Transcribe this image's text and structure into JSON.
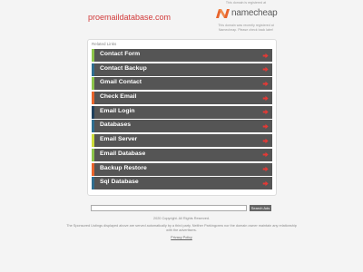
{
  "domain": "proemaildatabase.com",
  "registrar": {
    "registered_text": "This domain is registered at",
    "brand": "namecheap",
    "note": "This domain was recently registered at Namecheap. Please check back later!",
    "colors": {
      "brand_orange": "#e8642c",
      "brand_text": "#5a5a5a"
    }
  },
  "related": {
    "title": "Related Links",
    "items": [
      {
        "label": "Contact Form",
        "accent": "#8bc34a"
      },
      {
        "label": "Contact Backup",
        "accent": "#2f6d8f"
      },
      {
        "label": "Gmail Contact",
        "accent": "#8bc34a"
      },
      {
        "label": "Check Email",
        "accent": "#e8642c"
      },
      {
        "label": "Email Login",
        "accent": "#1f3f5c"
      },
      {
        "label": "Databases",
        "accent": "#2f6d8f"
      },
      {
        "label": "Email Server",
        "accent": "#cddc39"
      },
      {
        "label": "Email Database",
        "accent": "#8bc34a"
      },
      {
        "label": "Backup Restore",
        "accent": "#e8642c"
      },
      {
        "label": "Sql Database",
        "accent": "#2f6d8f"
      }
    ],
    "arrow_icon": "red-arrow-right-icon",
    "arrow_color": "#e53935"
  },
  "search": {
    "input_value": "",
    "button_label": "Search Ads"
  },
  "footer": {
    "copyright": "2020 Copyright. All Rights Reserved.",
    "disclaimer": "The Sponsored Listings displayed above are served automatically by a third party. Neither Parkingcrew nor the domain owner maintain any relationship with the advertisers.",
    "privacy_label": "Privacy Policy"
  }
}
